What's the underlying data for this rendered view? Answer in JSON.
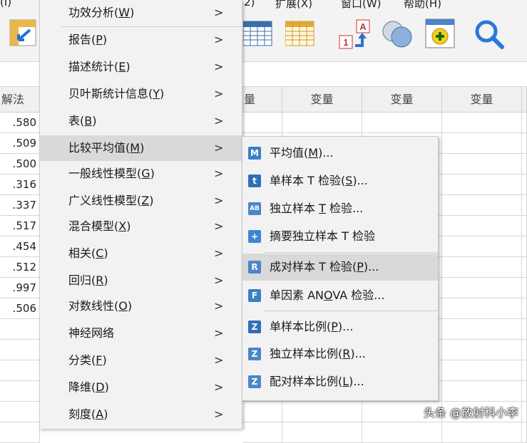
{
  "menubar": {
    "partial_left": "(I)",
    "partial_mid": "2)",
    "extend": "扩展(X)",
    "window": "窗口(W)",
    "help": "帮助(H)"
  },
  "grid": {
    "first_header": "解法",
    "var_headers": [
      "量",
      "变量",
      "变量",
      "变量"
    ],
    "values": [
      ".580",
      ".509",
      ".500",
      ".316",
      ".337",
      ".517",
      ".454",
      ".512",
      ".997",
      ".506"
    ]
  },
  "main_menu": [
    {
      "text": "功效分析(",
      "key": "W",
      "tail": ")"
    },
    {
      "text": "报告(",
      "key": "P",
      "tail": ")"
    },
    {
      "text": "描述统计(",
      "key": "E",
      "tail": ")"
    },
    {
      "text": "贝叶斯统计信息(",
      "key": "Y",
      "tail": ")"
    },
    {
      "text": "表(",
      "key": "B",
      "tail": ")"
    },
    {
      "text": "比较平均值(",
      "key": "M",
      "tail": ")"
    },
    {
      "text": "一般线性模型(",
      "key": "G",
      "tail": ")"
    },
    {
      "text": "广义线性模型(",
      "key": "Z",
      "tail": ")"
    },
    {
      "text": "混合模型(",
      "key": "X",
      "tail": ")"
    },
    {
      "text": "相关(",
      "key": "C",
      "tail": ")"
    },
    {
      "text": "回归(",
      "key": "R",
      "tail": ")"
    },
    {
      "text": "对数线性(",
      "key": "O",
      "tail": ")"
    },
    {
      "text": "神经网络",
      "key": "",
      "tail": ""
    },
    {
      "text": "分类(",
      "key": "F",
      "tail": ")"
    },
    {
      "text": "降维(",
      "key": "D",
      "tail": ")"
    },
    {
      "text": "刻度(",
      "key": "A",
      "tail": ")"
    }
  ],
  "arrow_glyph": ">",
  "submenu": [
    {
      "text": "平均值(",
      "key": "M",
      "tail": ")...",
      "icon": "means-icon",
      "glyph": "M",
      "color": "#3b7fc4"
    },
    {
      "text": "单样本 T 检验(",
      "key": "S",
      "tail": ")...",
      "icon": "one-sample-t-icon",
      "glyph": "t",
      "color": "#2f6fb8"
    },
    {
      "text": "独立样本 ",
      "key": "T",
      "tail": " 检验...",
      "icon": "independent-t-icon",
      "glyph": "AB",
      "color": "#4a86c8"
    },
    {
      "text": "摘要独立样本 T 检验",
      "key": "",
      "tail": "",
      "icon": "summary-t-icon",
      "glyph": "+",
      "color": "#3d86d0"
    },
    {
      "text": "成对样本 T 检验(",
      "key": "P",
      "tail": ")...",
      "icon": "paired-t-icon",
      "glyph": "R",
      "color": "#4a86c8"
    },
    {
      "text": "单因素 AN",
      "key": "O",
      "tail": "VA 检验...",
      "icon": "anova-icon",
      "glyph": "F",
      "color": "#3b7fc4"
    },
    {
      "text": "单样本比例(",
      "key": "P",
      "tail": ")...",
      "icon": "one-sample-proportion-icon",
      "glyph": "Z",
      "color": "#2f6fb8"
    },
    {
      "text": "独立样本比例(",
      "key": "R",
      "tail": ")...",
      "icon": "independent-proportion-icon",
      "glyph": "Z",
      "color": "#4a86c8"
    },
    {
      "text": "配对样本比例(",
      "key": "L",
      "tail": ")...",
      "icon": "paired-proportion-icon",
      "glyph": "Z",
      "color": "#4a86c8"
    }
  ],
  "watermark": "头条 @放射科小李"
}
